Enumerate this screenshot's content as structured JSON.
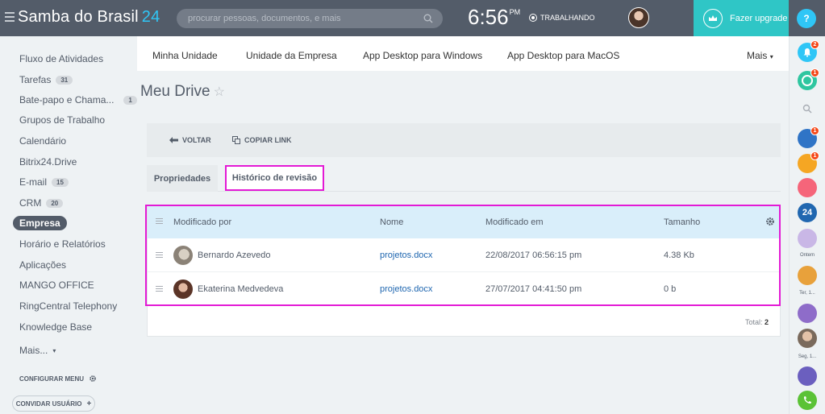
{
  "header": {
    "logo_name": "Samba do Brasil",
    "logo_num": "24",
    "search_placeholder": "procurar pessoas, documentos, e mais",
    "time": "6:56",
    "time_suffix": "PM",
    "status": "TRABALHANDO",
    "upgrade_label": "Fazer upgrade",
    "help_label": "?"
  },
  "sidebar": {
    "items": [
      {
        "label": "Fluxo de Atividades",
        "badge": ""
      },
      {
        "label": "Tarefas",
        "badge": "31"
      },
      {
        "label": "Bate-papo e Chama...",
        "badge": "1"
      },
      {
        "label": "Grupos de Trabalho",
        "badge": ""
      },
      {
        "label": "Calendário",
        "badge": ""
      },
      {
        "label": "Bitrix24.Drive",
        "badge": ""
      },
      {
        "label": "E-mail",
        "badge": "15"
      },
      {
        "label": "CRM",
        "badge": "20"
      },
      {
        "label": "Empresa",
        "badge": ""
      },
      {
        "label": "Horário e Relatórios",
        "badge": ""
      },
      {
        "label": "Aplicações",
        "badge": ""
      },
      {
        "label": "MANGO OFFICE",
        "badge": ""
      },
      {
        "label": "RingCentral Telephony",
        "badge": ""
      },
      {
        "label": "Knowledge Base",
        "badge": ""
      },
      {
        "label": "Mais...",
        "badge": ""
      }
    ],
    "configure_label": "CONFIGURAR MENU",
    "invite_label": "CONVIDAR USUÁRIO"
  },
  "topnav": {
    "items": [
      "Minha Unidade",
      "Unidade da Empresa",
      "App Desktop para Windows",
      "App Desktop para MacOS"
    ],
    "more": "Mais"
  },
  "page": {
    "title": "Meu Drive",
    "back_label": "VOLTAR",
    "copy_link_label": "COPIAR LINK",
    "tabs": [
      "Propriedades",
      "Histórico de revisão"
    ]
  },
  "grid": {
    "columns": [
      "Modificado por",
      "Nome",
      "Modificado em",
      "Tamanho"
    ],
    "rows": [
      {
        "user": "Bernardo Azevedo",
        "name": "projetos.docx",
        "modified": "22/08/2017 06:56:15 pm",
        "size": "4.38 Kb"
      },
      {
        "user": "Ekaterina Medvedeva",
        "name": "projetos.docx",
        "modified": "27/07/2017 04:41:50 pm",
        "size": "0 b"
      }
    ],
    "total_label": "Total:",
    "total_value": "2"
  },
  "right_panel": {
    "badges": [
      "2",
      "1",
      "1",
      "1"
    ],
    "captions": [
      "Ontem",
      "Ter, 1...",
      "Seg, 1..."
    ],
    "chat_24_label": "24"
  },
  "colors": {
    "header_bg": "#535c69",
    "accent": "#2fc6f6",
    "upgrade": "#2fc6c6",
    "highlight": "#e31ad5",
    "grid_head": "#d9eefa"
  }
}
